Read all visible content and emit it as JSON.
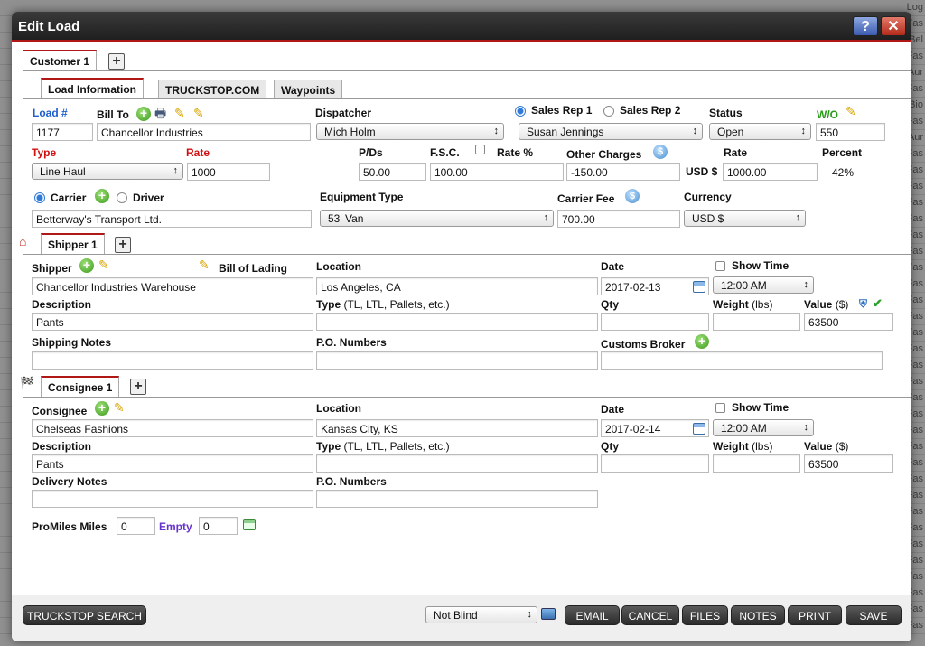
{
  "window": {
    "title": "Edit Load"
  },
  "background_rows": [
    "Log",
    "Fas",
    "Bel",
    "Fas",
    "Aur",
    "Fas",
    "Bio",
    "Fas",
    "Aur",
    "Fas",
    "Fas",
    "Fas",
    "Fas",
    "Fas",
    "Fas",
    "Fas",
    "Fas",
    "Fas",
    "Fas",
    "Fas",
    "Fas",
    "Fas",
    "Fas",
    "Fas",
    "Fas",
    "Fas",
    "Fas",
    "Fas",
    "Fas",
    "Fas",
    "Fas",
    "Fas",
    "Fas",
    "Fas",
    "Fas",
    "Fas",
    "Fas",
    "Fas",
    "Fas"
  ],
  "customer_tabs": {
    "tab": "Customer 1",
    "add": "+"
  },
  "load_tabs": [
    "Load Information",
    "TRUCKSTOP.COM",
    "Waypoints"
  ],
  "load": {
    "load_num_label": "Load #",
    "load_num": "1177",
    "bill_to_label": "Bill To",
    "bill_to": "Chancellor Industries",
    "dispatcher_label": "Dispatcher",
    "dispatcher": "Mich Holm",
    "sales_rep1_label": "Sales Rep 1",
    "sales_rep2_label": "Sales Rep 2",
    "sales_rep": "Susan Jennings",
    "status_label": "Status",
    "status": "Open",
    "wo_label": "W/O",
    "wo": "550",
    "type_label": "Type",
    "type": "Line Haul",
    "rate_label": "Rate",
    "rate": "1000",
    "pds_label": "P/Ds",
    "pds": "50.00",
    "fsc_label": "F.S.C.",
    "rate_pct_label": "Rate %",
    "fsc": "100.00",
    "other_charges_label": "Other Charges",
    "other_charges": "-150.00",
    "rate2_label": "Rate",
    "rate2_currency": "USD $",
    "rate2": "1000.00",
    "percent_label": "Percent",
    "percent": "42%",
    "carrier_label": "Carrier",
    "driver_label": "Driver",
    "carrier": "Betterway's Transport Ltd.",
    "equipment_label": "Equipment Type",
    "equipment": "53' Van",
    "carrier_fee_label": "Carrier Fee",
    "carrier_fee": "700.00",
    "currency_label": "Currency",
    "currency": "USD $"
  },
  "shipper": {
    "tab": "Shipper 1",
    "label": "Shipper",
    "bol_label": "Bill of Lading",
    "name": "Chancellor Industries Warehouse",
    "location_label": "Location",
    "location": "Los Angeles, CA",
    "date_label": "Date",
    "date": "2017-02-13",
    "show_time_label": "Show Time",
    "time": "12:00 AM",
    "description_label": "Description",
    "description": "Pants",
    "type_label": "Type",
    "type_hint": "(TL, LTL, Pallets, etc.)",
    "qty_label": "Qty",
    "weight_label": "Weight",
    "weight_unit": "(lbs)",
    "value_label": "Value",
    "value_unit": "($)",
    "value": "63500",
    "notes_label": "Shipping Notes",
    "po_label": "P.O. Numbers",
    "customs_label": "Customs Broker"
  },
  "consignee": {
    "tab": "Consignee 1",
    "label": "Consignee",
    "name": "Chelseas Fashions",
    "location_label": "Location",
    "location": "Kansas City, KS",
    "date_label": "Date",
    "date": "2017-02-14",
    "show_time_label": "Show Time",
    "time": "12:00 AM",
    "description_label": "Description",
    "description": "Pants",
    "type_label": "Type",
    "type_hint": "(TL, LTL, Pallets, etc.)",
    "qty_label": "Qty",
    "weight_label": "Weight",
    "weight_unit": "(lbs)",
    "value_label": "Value",
    "value_unit": "($)",
    "value": "63500",
    "notes_label": "Delivery Notes",
    "po_label": "P.O. Numbers"
  },
  "miles": {
    "promiles_label": "ProMiles Miles",
    "promiles": "0",
    "empty_label": "Empty",
    "empty": "0"
  },
  "footer": {
    "truckstop_search": "TRUCKSTOP SEARCH",
    "blind": "Not Blind",
    "email": "EMAIL",
    "cancel": "CANCEL",
    "files": "FILES",
    "notes": "NOTES",
    "print": "PRINT",
    "save": "SAVE"
  },
  "colors": {
    "accent_red": "#b01818",
    "label_red": "#d01010",
    "label_blue": "#1f5fcc",
    "label_green": "#2a9a1a",
    "label_purple": "#6633cc"
  }
}
